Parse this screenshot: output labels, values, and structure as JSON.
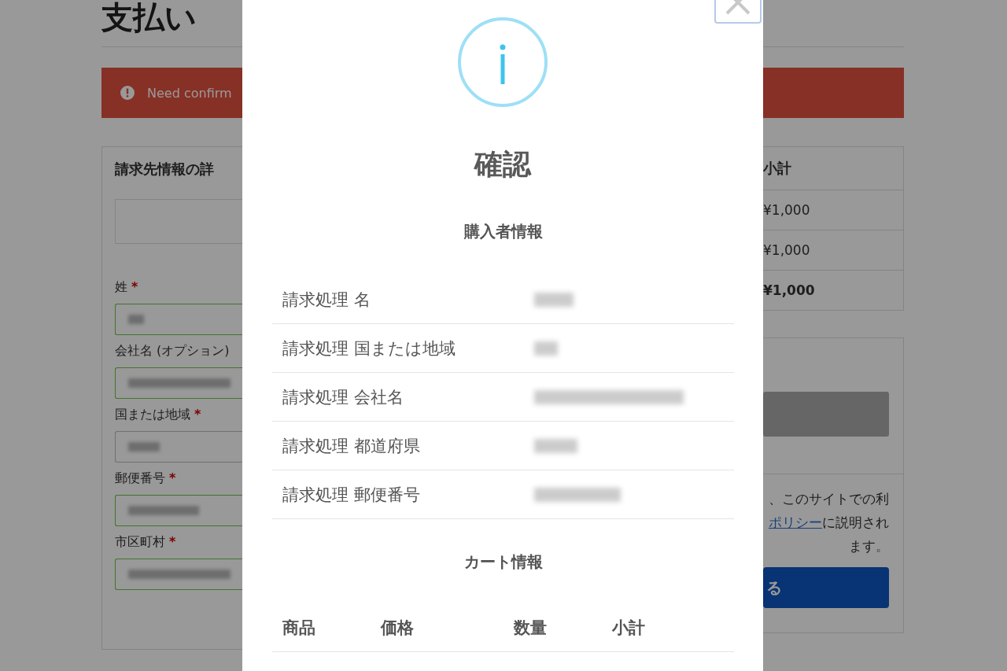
{
  "page": {
    "title": "支払い",
    "notice": {
      "text": "Need confirm"
    },
    "billing": {
      "heading": "請求先情報の詳",
      "fields": [
        {
          "label": "姓",
          "required_mark": "*",
          "valid": true,
          "redacted": true
        },
        {
          "label": "会社名 (オプション)",
          "valid": true,
          "redacted": true
        },
        {
          "label": "国または地域",
          "required_mark": "*",
          "valid": false,
          "redacted": true
        },
        {
          "label": "郵便番号",
          "required_mark": "*",
          "valid": true,
          "redacted": true
        },
        {
          "label": "市区町村",
          "required_mark": "*",
          "valid": true,
          "redacted": true
        }
      ]
    },
    "order_summary": {
      "heading": "小計",
      "rows": [
        {
          "text": "¥1,000",
          "bold": false
        },
        {
          "text": "¥1,000",
          "bold": false
        },
        {
          "text": "¥1,000",
          "bold": true
        }
      ]
    },
    "payment": {
      "privacy_lines": [
        {
          "text": "、このサイトでの利"
        },
        {
          "link": "ポリシー",
          "text": "に説明され"
        },
        {
          "text": "ます。"
        }
      ],
      "place_order_button": "る"
    }
  },
  "dialog": {
    "title": "確認",
    "sections": [
      {
        "kind": "details",
        "heading": "購入者情報",
        "rows": [
          {
            "label": "請求処理 名",
            "redacted": true
          },
          {
            "label": "請求処理 国または地域",
            "redacted": true
          },
          {
            "label": "請求処理 会社名",
            "redacted": true
          },
          {
            "label": "請求処理 都道府県",
            "redacted": true
          },
          {
            "label": "請求処理 郵便番号",
            "redacted": true
          }
        ]
      },
      {
        "kind": "table",
        "heading": "カート情報",
        "columns": [
          "商品",
          "価格",
          "数量",
          "小計"
        ]
      }
    ]
  }
}
